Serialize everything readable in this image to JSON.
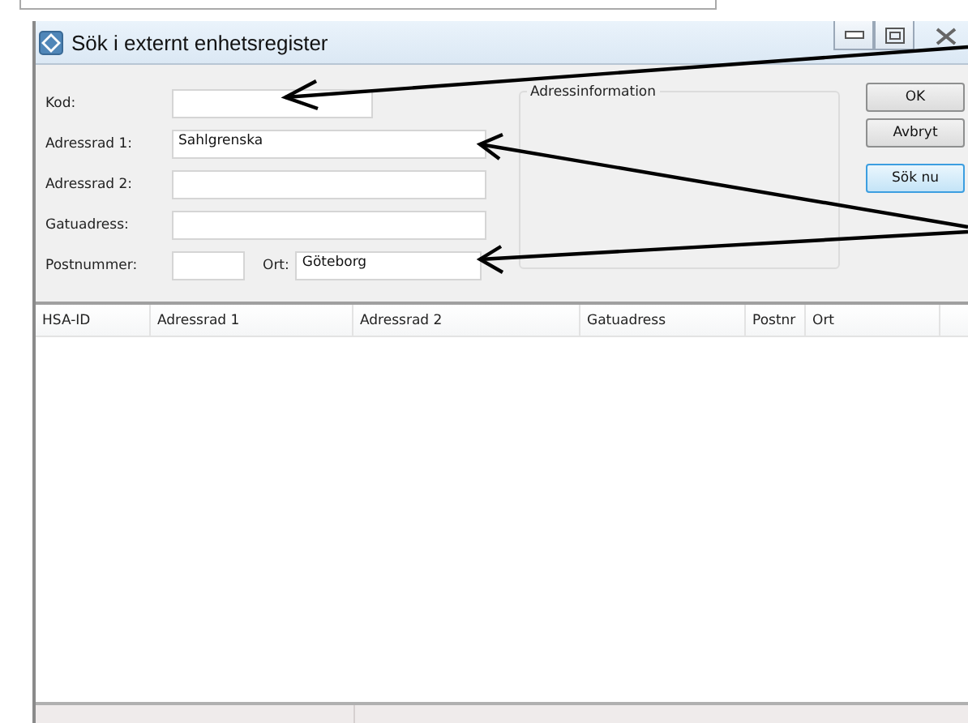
{
  "window": {
    "title": "Sök i externt enhetsregister"
  },
  "form": {
    "fields": [
      {
        "kind": "short",
        "label": "Kod:"
      },
      {
        "kind": "wide",
        "label": "Adressrad 1:",
        "value": "Sahlgrenska"
      },
      {
        "kind": "wide",
        "label": "Adressrad 2:"
      },
      {
        "kind": "wide",
        "label": "Gatuadress:"
      },
      {
        "kind": "pair",
        "label": "Postnummer:",
        "second_label": "Ort:",
        "second_value": "Göteborg"
      }
    ],
    "group_title": "Adressinformation"
  },
  "buttons": [
    {
      "label": "OK",
      "focused": false
    },
    {
      "label": "Avbryt",
      "focused": false
    },
    {
      "label": "Sök nu",
      "focused": true
    }
  ],
  "table": {
    "columns": [
      "HSA-ID",
      "Adressrad 1",
      "Adressrad 2",
      "Gatuadress",
      "Postnr",
      "Ort"
    ]
  }
}
